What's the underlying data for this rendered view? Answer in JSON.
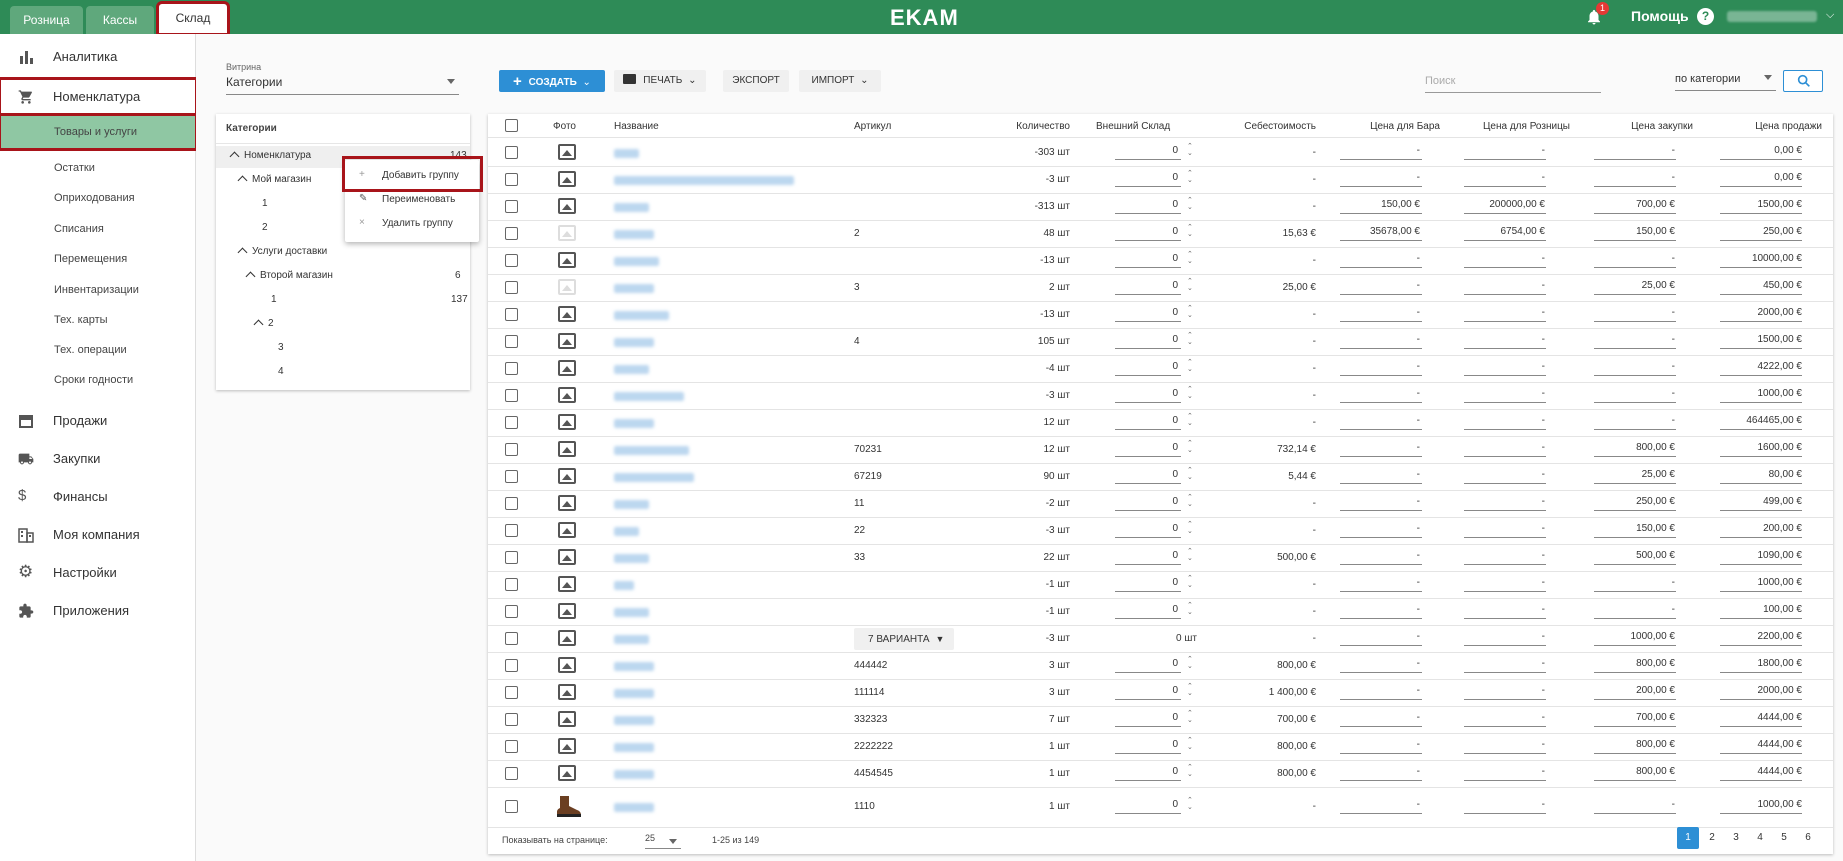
{
  "topbar": {
    "tabs": [
      {
        "label": "Розница"
      },
      {
        "label": "Кассы"
      },
      {
        "label": "Склад"
      }
    ],
    "logo": "EKAM",
    "notifications_count": "1",
    "help_label": "Помощь",
    "help_icon": "?"
  },
  "sidebar": {
    "items": [
      {
        "label": "Аналитика",
        "icon": "bar-chart-icon"
      },
      {
        "label": "Номенклатура",
        "icon": "cart-icon"
      },
      {
        "label": "Продажи",
        "icon": "store-icon"
      },
      {
        "label": "Закупки",
        "icon": "truck-icon"
      },
      {
        "label": "Финансы",
        "icon": "dollar-icon"
      },
      {
        "label": "Моя компания",
        "icon": "building-icon"
      },
      {
        "label": "Настройки",
        "icon": "gear-icon"
      },
      {
        "label": "Приложения",
        "icon": "puzzle-icon"
      }
    ],
    "subitems": [
      {
        "label": "Товары и услуги"
      },
      {
        "label": "Остатки"
      },
      {
        "label": "Оприходования"
      },
      {
        "label": "Списания"
      },
      {
        "label": "Перемещения"
      },
      {
        "label": "Инвентаризации"
      },
      {
        "label": "Тех. карты"
      },
      {
        "label": "Тех. операции"
      },
      {
        "label": "Сроки годности"
      }
    ]
  },
  "filters": {
    "vitrina_label": "Витрина",
    "vitrina_value": "Категории",
    "search_placeholder": "Поиск",
    "search_mode": "по категории"
  },
  "toolbar": {
    "create": "СОЗДАТЬ",
    "print": "ПЕЧАТЬ",
    "export": "ЭКСПОРТ",
    "import": "ИМПОРТ"
  },
  "categories": {
    "header": "Категории",
    "tree": [
      {
        "label": "Номенклатура",
        "count": "143"
      },
      {
        "label": "Мой магазин",
        "count": ""
      },
      {
        "label": "1",
        "count": ""
      },
      {
        "label": "2",
        "count": ""
      },
      {
        "label": "Услуги доставки",
        "count": ""
      },
      {
        "label": "Второй магазин",
        "count": "6"
      },
      {
        "label": "1",
        "count": "137"
      },
      {
        "label": "2",
        "count": ""
      },
      {
        "label": "3",
        "count": ""
      },
      {
        "label": "4",
        "count": ""
      }
    ]
  },
  "context_menu": {
    "items": [
      {
        "icon": "+",
        "label": "Добавить группу"
      },
      {
        "icon": "✎",
        "label": "Переименовать"
      },
      {
        "icon": "×",
        "label": "Удалить группу"
      }
    ]
  },
  "table": {
    "headers": [
      "Фото",
      "Название",
      "Артикул",
      "Количество",
      "Внешний Склад",
      "Себестоимость",
      "Цена для Бара",
      "Цена для Розницы",
      "Цена закупки",
      "Цена продажи"
    ],
    "rows": [
      {
        "article": "",
        "qty": "-303 шт",
        "ext": "0",
        "cost": "-",
        "bar": "-",
        "retail": "-",
        "purchase": "-",
        "sale": "0,00 €"
      },
      {
        "article": "",
        "qty": "-3 шт",
        "ext": "0",
        "cost": "-",
        "bar": "-",
        "retail": "-",
        "purchase": "-",
        "sale": "0,00 €"
      },
      {
        "article": "",
        "qty": "-313 шт",
        "ext": "0",
        "cost": "-",
        "bar": "150,00 €",
        "retail": "200000,00 €",
        "purchase": "700,00 €",
        "sale": "1500,00 €"
      },
      {
        "article": "2",
        "qty": "48 шт",
        "ext": "0",
        "cost": "15,63 €",
        "bar": "35678,00 €",
        "retail": "6754,00 €",
        "purchase": "150,00 €",
        "sale": "250,00 €"
      },
      {
        "article": "",
        "qty": "-13 шт",
        "ext": "0",
        "cost": "-",
        "bar": "-",
        "retail": "-",
        "purchase": "-",
        "sale": "10000,00 €"
      },
      {
        "article": "3",
        "qty": "2 шт",
        "ext": "0",
        "cost": "25,00 €",
        "bar": "-",
        "retail": "-",
        "purchase": "25,00 €",
        "sale": "450,00 €"
      },
      {
        "article": "",
        "qty": "-13 шт",
        "ext": "0",
        "cost": "-",
        "bar": "-",
        "retail": "-",
        "purchase": "-",
        "sale": "2000,00 €"
      },
      {
        "article": "4",
        "qty": "105 шт",
        "ext": "0",
        "cost": "-",
        "bar": "-",
        "retail": "-",
        "purchase": "-",
        "sale": "1500,00 €"
      },
      {
        "article": "",
        "qty": "-4 шт",
        "ext": "0",
        "cost": "-",
        "bar": "-",
        "retail": "-",
        "purchase": "-",
        "sale": "4222,00 €"
      },
      {
        "article": "",
        "qty": "-3 шт",
        "ext": "0",
        "cost": "-",
        "bar": "-",
        "retail": "-",
        "purchase": "-",
        "sale": "1000,00 €"
      },
      {
        "article": "",
        "qty": "12 шт",
        "ext": "0",
        "cost": "-",
        "bar": "-",
        "retail": "-",
        "purchase": "-",
        "sale": "464465,00 €"
      },
      {
        "article": "70231",
        "qty": "12 шт",
        "ext": "0",
        "cost": "732,14 €",
        "bar": "-",
        "retail": "-",
        "purchase": "800,00 €",
        "sale": "1600,00 €"
      },
      {
        "article": "67219",
        "qty": "90 шт",
        "ext": "0",
        "cost": "5,44 €",
        "bar": "-",
        "retail": "-",
        "purchase": "25,00 €",
        "sale": "80,00 €"
      },
      {
        "article": "11",
        "qty": "-2 шт",
        "ext": "0",
        "cost": "-",
        "bar": "-",
        "retail": "-",
        "purchase": "250,00 €",
        "sale": "499,00 €"
      },
      {
        "article": "22",
        "qty": "-3 шт",
        "ext": "0",
        "cost": "-",
        "bar": "-",
        "retail": "-",
        "purchase": "150,00 €",
        "sale": "200,00 €"
      },
      {
        "article": "33",
        "qty": "22 шт",
        "ext": "0",
        "cost": "500,00 €",
        "bar": "-",
        "retail": "-",
        "purchase": "500,00 €",
        "sale": "1090,00 €"
      },
      {
        "article": "",
        "qty": "-1 шт",
        "ext": "0",
        "cost": "-",
        "bar": "-",
        "retail": "-",
        "purchase": "-",
        "sale": "1000,00 €"
      },
      {
        "article": "",
        "qty": "-1 шт",
        "ext": "0",
        "cost": "-",
        "bar": "-",
        "retail": "-",
        "purchase": "-",
        "sale": "100,00 €"
      },
      {
        "article": "7 ВАРИАНТА",
        "qty": "-3 шт",
        "ext": "0 шт",
        "cost": "-",
        "bar": "-",
        "retail": "-",
        "purchase": "1000,00 €",
        "sale": "2200,00 €"
      },
      {
        "article": "444442",
        "qty": "3 шт",
        "ext": "0",
        "cost": "800,00 €",
        "bar": "-",
        "retail": "-",
        "purchase": "800,00 €",
        "sale": "1800,00 €"
      },
      {
        "article": "111114",
        "qty": "3 шт",
        "ext": "0",
        "cost": "1 400,00 €",
        "bar": "-",
        "retail": "-",
        "purchase": "200,00 €",
        "sale": "2000,00 €"
      },
      {
        "article": "332323",
        "qty": "7 шт",
        "ext": "0",
        "cost": "700,00 €",
        "bar": "-",
        "retail": "-",
        "purchase": "700,00 €",
        "sale": "4444,00 €"
      },
      {
        "article": "2222222",
        "qty": "1 шт",
        "ext": "0",
        "cost": "800,00 €",
        "bar": "-",
        "retail": "-",
        "purchase": "800,00 €",
        "sale": "4444,00 €"
      },
      {
        "article": "4454545",
        "qty": "1 шт",
        "ext": "0",
        "cost": "800,00 €",
        "bar": "-",
        "retail": "-",
        "purchase": "800,00 €",
        "sale": "4444,00 €"
      },
      {
        "article": "1110",
        "qty": "1 шт",
        "ext": "0",
        "cost": "-",
        "bar": "-",
        "retail": "-",
        "purchase": "-",
        "sale": "1000,00 €"
      }
    ]
  },
  "footer": {
    "per_page_label": "Показывать на странице:",
    "per_page_value": "25",
    "range": "1-25 из 149",
    "pages": [
      "1",
      "2",
      "3",
      "4",
      "5",
      "6"
    ]
  }
}
